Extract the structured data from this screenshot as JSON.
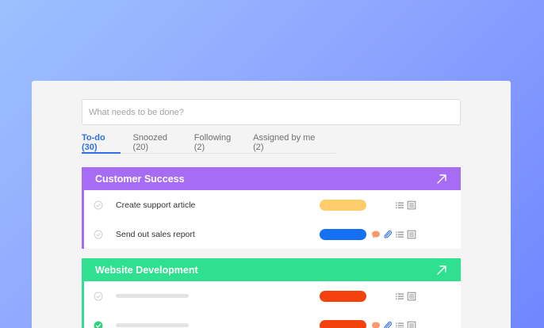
{
  "search": {
    "placeholder": "What needs to be done?"
  },
  "tabs": [
    {
      "label": "To-do (30)",
      "active": true
    },
    {
      "label": "Snoozed (20)",
      "active": false
    },
    {
      "label": "Following (2)",
      "active": false
    },
    {
      "label": "Assigned by me (2)",
      "active": false
    }
  ],
  "groups": [
    {
      "title": "Customer Success",
      "color": "#a66cf3",
      "tasks": [
        {
          "label": "Create support article",
          "done": false,
          "status_color": "#ffcd6b",
          "has_comment": false,
          "has_attachment": false
        },
        {
          "label": "Send out sales report",
          "done": false,
          "status_color": "#1570f5",
          "has_comment": true,
          "has_attachment": true
        }
      ]
    },
    {
      "title": "Website Development",
      "color": "#2ee08f",
      "tasks": [
        {
          "label": "",
          "done": false,
          "status_color": "#f4420f",
          "has_comment": false,
          "has_attachment": false
        },
        {
          "label": "",
          "done": true,
          "status_color": "#f4420f",
          "has_comment": true,
          "has_attachment": true
        }
      ]
    }
  ],
  "colors": {
    "accent": "#2f6fe8",
    "comment_icon": "#f79a6a",
    "attachment_icon": "#2f6fe8",
    "done_check": "#2ed27f"
  },
  "icons": [
    "arrow-expand-icon",
    "checkbox-icon",
    "comment-icon",
    "attachment-icon",
    "list-icon",
    "notes-icon"
  ]
}
